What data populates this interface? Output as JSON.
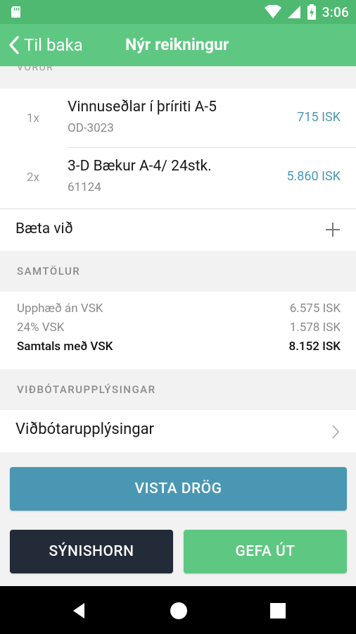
{
  "status_bar": {
    "time": "3:06",
    "icons": [
      "sd-card-icon",
      "wifi-icon",
      "signal-icon",
      "battery-icon"
    ]
  },
  "app_bar": {
    "back_label": "Til baka",
    "title": "Nýr reikningur"
  },
  "products": {
    "section_header": "VÖRUR",
    "items": [
      {
        "qty": "1x",
        "name": "Vinnuseðlar í þríriti A-5",
        "code": "OD-3023",
        "price": "715 ISK"
      },
      {
        "qty": "2x",
        "name": "3-D Bækur A-4/ 24stk.",
        "code": "61124",
        "price": "5.860 ISK"
      }
    ],
    "add_label": "Bæta við"
  },
  "totals": {
    "section_header": "SAMTÖLUR",
    "rows": [
      {
        "label": "Upphæð án VSK",
        "value": "6.575 ISK"
      },
      {
        "label": "24% VSK",
        "value": "1.578 ISK"
      },
      {
        "label": "Samtals með VSK",
        "value": "8.152 ISK"
      }
    ]
  },
  "additional": {
    "section_header": "VIÐBÓTARUPPLÝSINGAR",
    "row_label": "Viðbótarupplýsingar"
  },
  "buttons": {
    "save_draft": "VISTA DRÖG",
    "preview": "SÝNISHORN",
    "issue": "GEFA ÚT"
  },
  "colors": {
    "primary_green": "#5ec882",
    "status_green": "#4fb971",
    "accent_blue": "#4a97b3",
    "dark_navy": "#232a38"
  }
}
